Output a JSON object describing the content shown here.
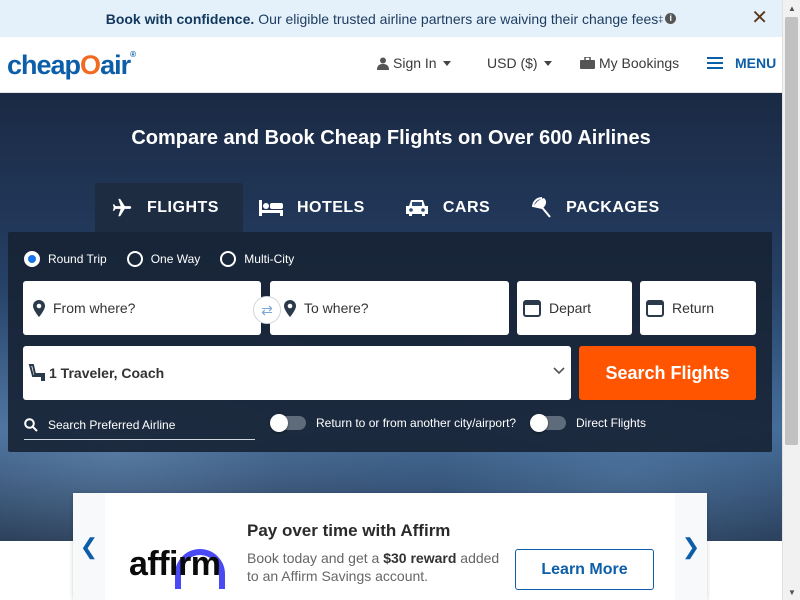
{
  "banner": {
    "bold": "Book with confidence.",
    "text": "Our eligible trusted airline partners are waiving their change fees",
    "mark": "‡",
    "info_icon": "info-icon",
    "close_icon": "close-icon",
    "close": "✕"
  },
  "header": {
    "logo_a": "cheap",
    "logo_o": "O",
    "logo_b": "air",
    "logo_reg": "®",
    "sign_in": "Sign In",
    "currency": "USD ($)",
    "bookings": "My Bookings",
    "menu": "MENU"
  },
  "hero": {
    "title": "Compare and Book Cheap Flights on Over 600 Airlines"
  },
  "tabs": [
    {
      "label": "FLIGHTS",
      "icon": "plane-icon"
    },
    {
      "label": "HOTELS",
      "icon": "bed-icon"
    },
    {
      "label": "CARS",
      "icon": "car-icon"
    },
    {
      "label": "PACKAGES",
      "icon": "beach-umbrella-icon"
    }
  ],
  "trip_types": [
    {
      "label": "Round Trip",
      "checked": true
    },
    {
      "label": "One Way",
      "checked": false
    },
    {
      "label": "Multi-City",
      "checked": false
    }
  ],
  "form": {
    "from_placeholder": "From where?",
    "to_placeholder": "To where?",
    "depart": "Depart",
    "return": "Return",
    "travelers": "1 Traveler, Coach",
    "search_button": "Search Flights",
    "airline_placeholder": "Search Preferred Airline",
    "return_other_city": "Return to or from another city/airport?",
    "direct_flights": "Direct Flights"
  },
  "promo": {
    "logo": "affirm",
    "title": "Pay over time with Affirm",
    "desc_before": "Book today and get a",
    "reward": "$30 reward",
    "desc_after": "added to an Affirm Savings account.",
    "button": "Learn More",
    "prev": "❮",
    "next": "❯"
  },
  "colors": {
    "brand_blue": "#0d5ea8",
    "cta_orange": "#ff5400",
    "affirm_blue": "#4a4af4"
  }
}
